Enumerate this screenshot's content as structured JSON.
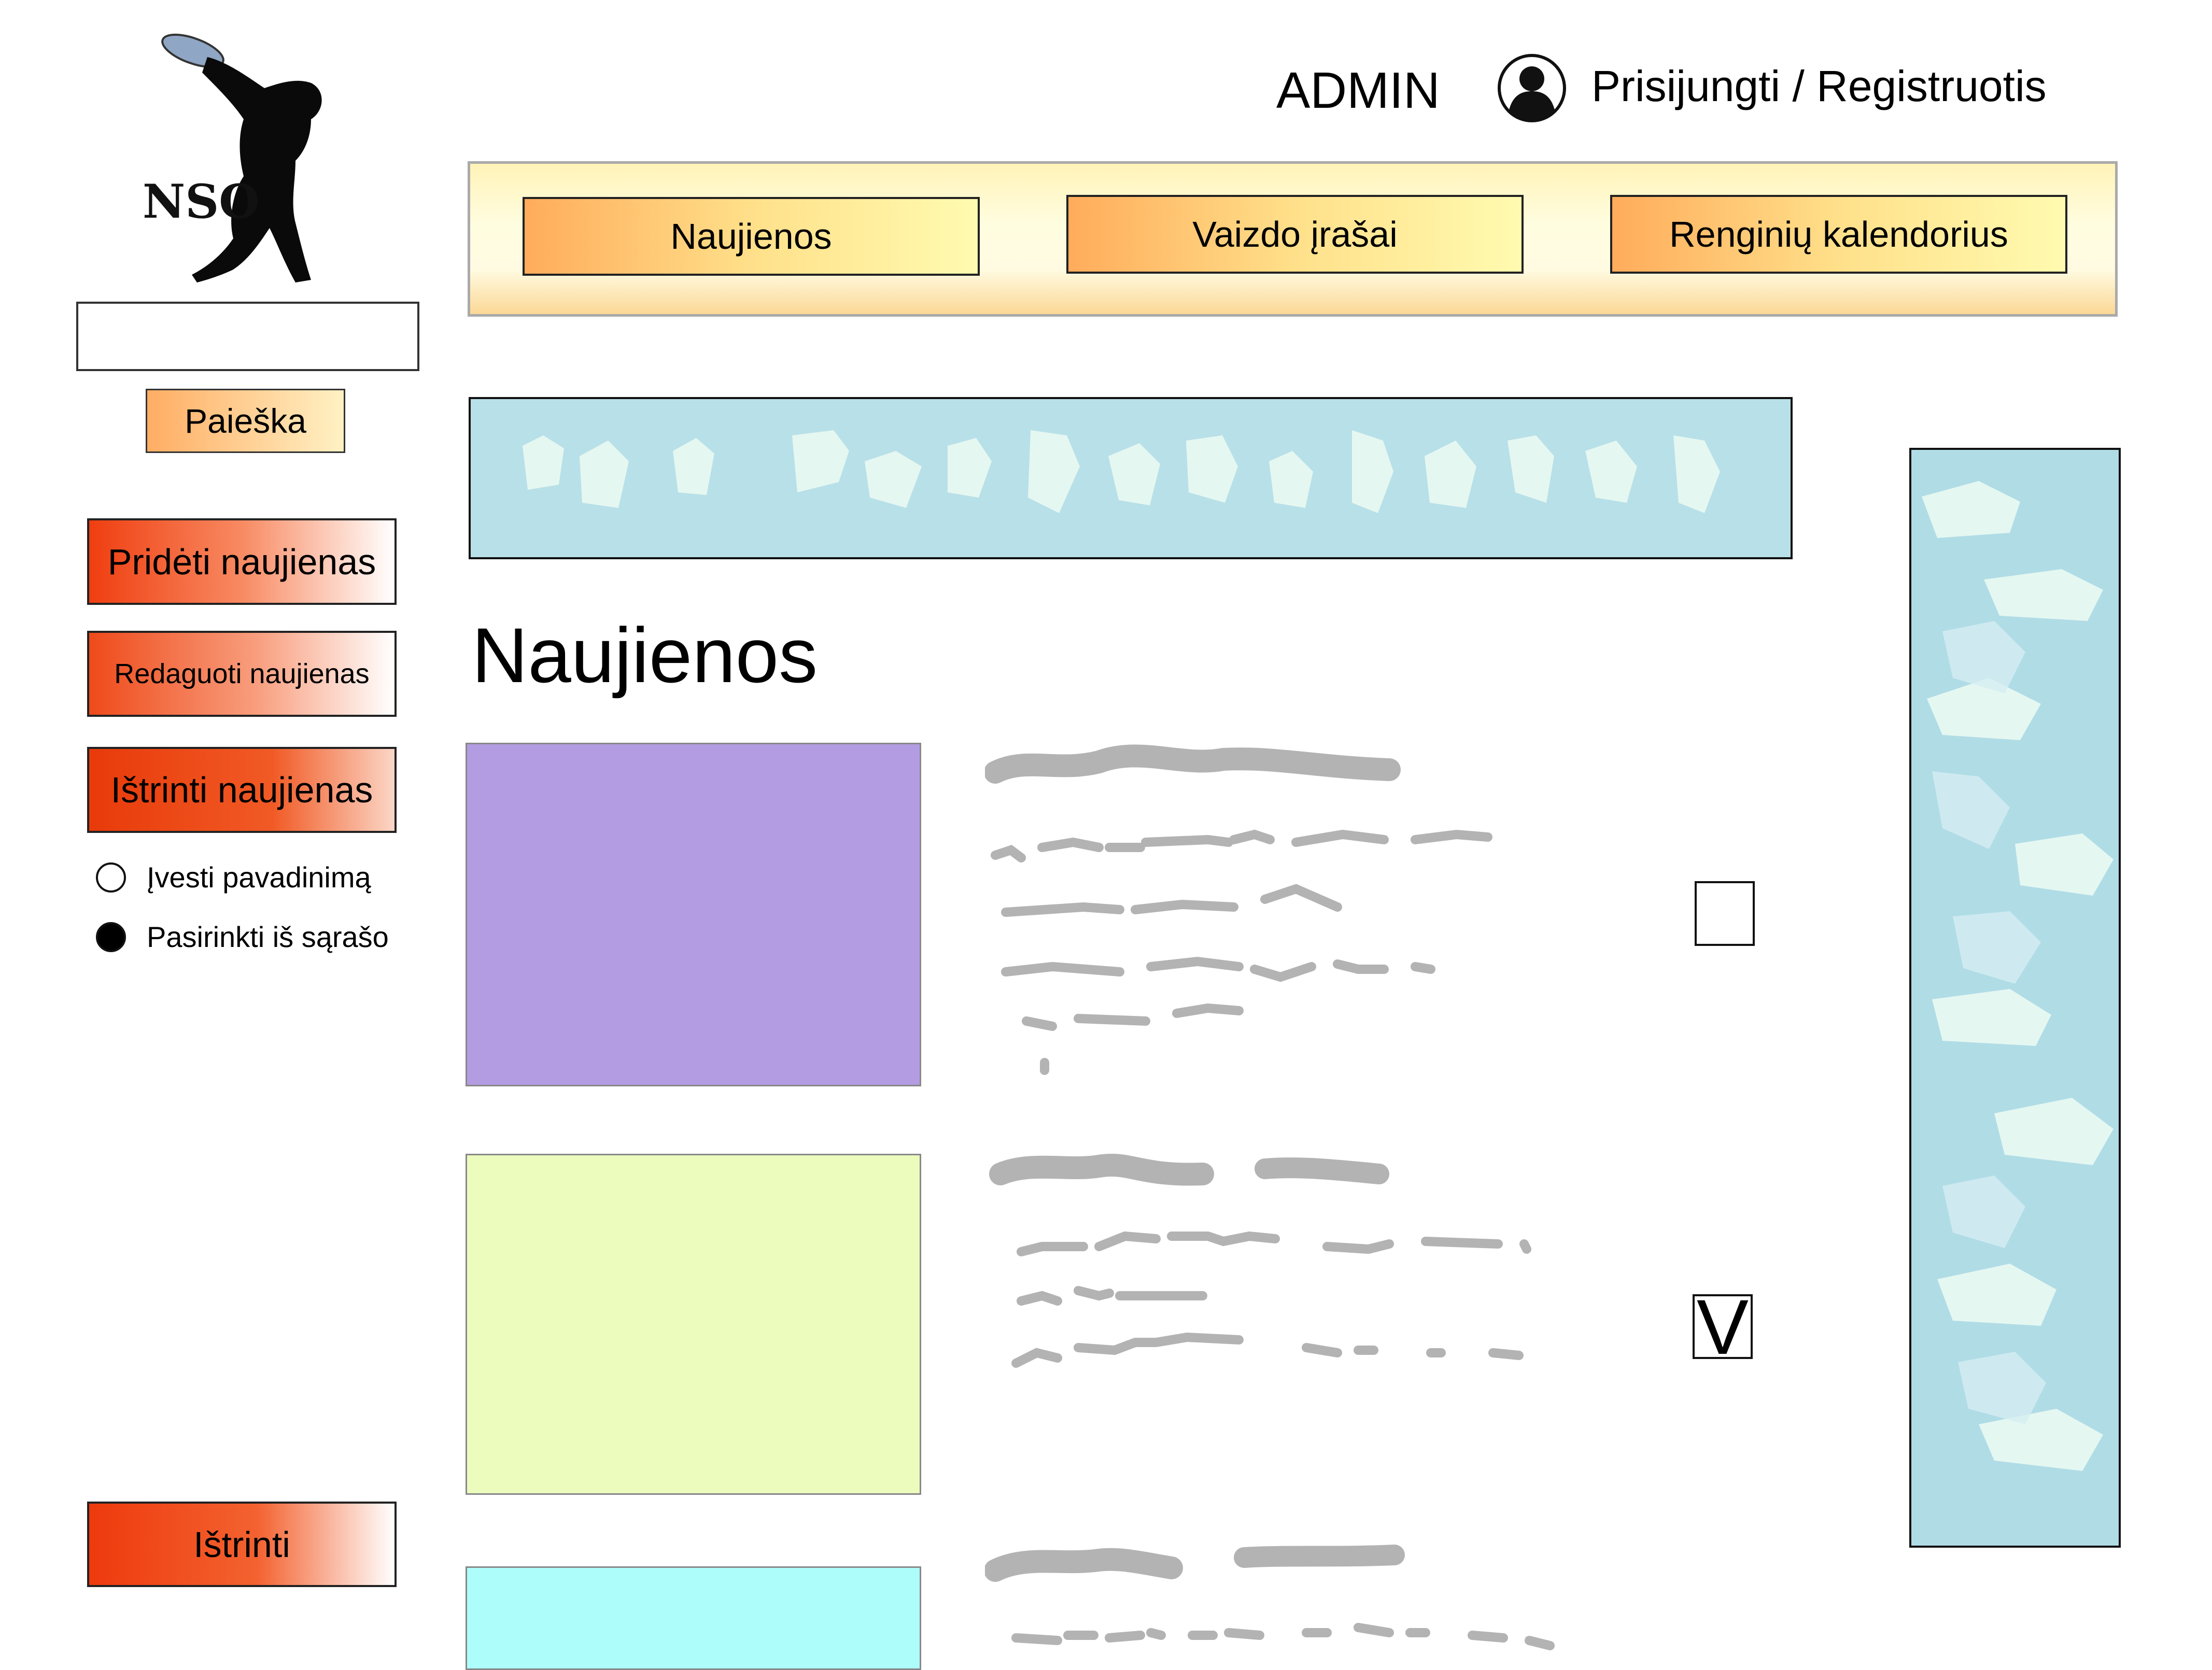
{
  "logo": {
    "icon": "discus-thrower-logo",
    "text": "NSO"
  },
  "search": {
    "placeholder": "",
    "value": "",
    "button_label": "Paieška"
  },
  "sidebar": {
    "add_news": "Pridėti naujienas",
    "edit_news": "Redaguoti naujienas",
    "delete_news": "Ištrinti naujienas",
    "radio_enter_name": "Įvesti pavadinimą",
    "radio_choose_list": "Pasirinkti iš sąrašo",
    "delete": "Ištrinti"
  },
  "header": {
    "admin": "ADMIN",
    "user_icon": "user-icon",
    "login": "Prisijungti / Registruotis"
  },
  "nav": {
    "news": "Naujienos",
    "video": "Vaizdo įrašai",
    "events": "Renginių kalendorius"
  },
  "main": {
    "title": "Naujienos",
    "items": [
      {
        "thumb_color": "#b39ce2",
        "checked": false
      },
      {
        "thumb_color": "#ebfcbd",
        "checked": true,
        "check_mark": "V"
      },
      {
        "thumb_color": "#adfdfb"
      }
    ]
  },
  "colors": {
    "nav_gradient_start": "#ffac5b",
    "side_button_red": "#ef3e10",
    "banner": "#b8e0e8"
  }
}
